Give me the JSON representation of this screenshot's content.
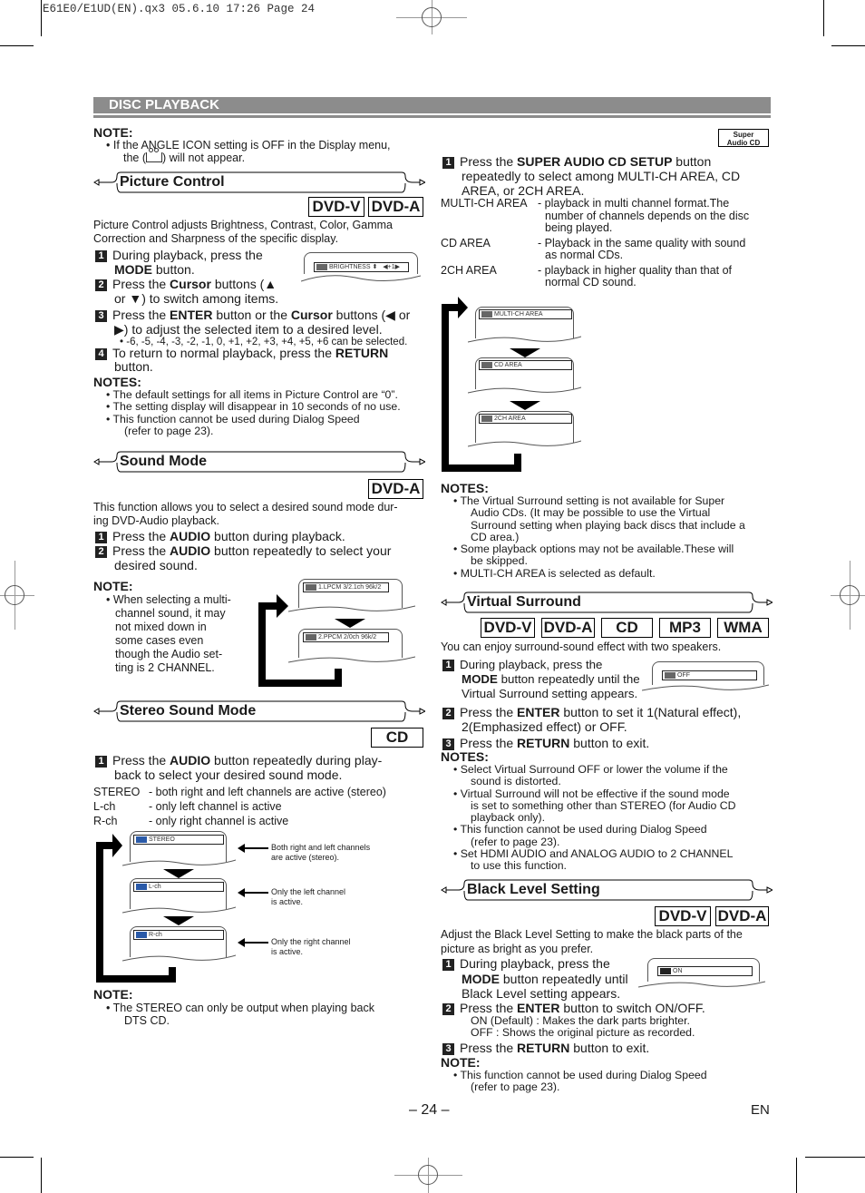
{
  "print_header": "E61E0/E1UD(EN).qx3   05.6.10 17:26   Page 24",
  "section_band": "DISC PLAYBACK",
  "top_note": {
    "heading": "NOTE:",
    "line1": "If the ANGLE ICON setting is OFF in the Display menu,",
    "line2a": "the (",
    "line2b": ") will not appear.",
    "icon": "angle-camera-icon"
  },
  "picture_control": {
    "title": "Picture Control",
    "badges": [
      "DVD-V",
      "DVD-A"
    ],
    "intro1": "Picture Control adjusts Brightness, Contrast, Color, Gamma",
    "intro2": "Correction and Sharpness of the specific display.",
    "step1a": "During playback, press the",
    "step1b_bold": "MODE",
    "step1b": " button.",
    "step2a": "Press the ",
    "step2a_bold": "Cursor",
    "step2a_end": " buttons (▲",
    "step2b": "or ▼) to switch among items.",
    "step3a": "Press the ",
    "step3a_bold1": "ENTER",
    "step3a_mid": " button or the ",
    "step3a_bold2": "Cursor",
    "step3a_end": " buttons (◀ or",
    "step3b": "▶) to adjust the selected item to a desired level.",
    "step3_note": "-6, -5, -4, -3, -2, -1, 0, +1, +2, +3, +4, +5, +6 can be selected.",
    "step4a": "To return to normal playback, press the ",
    "step4a_bold": "RETURN",
    "step4b": "button.",
    "screen": {
      "icon": "PICT",
      "label": "BRIGHTNESS",
      "updown": "⬍",
      "value": "◀+1▶"
    },
    "notes_heading": "NOTES:",
    "notes": [
      "The default settings for all items in Picture Control are “0”.",
      "The setting display will disappear in 10 seconds of no use.",
      "This function cannot be used during Dialog Speed",
      "(refer to page 23)."
    ]
  },
  "sound_mode": {
    "title": "Sound Mode",
    "badges": [
      "DVD-A"
    ],
    "intro1": "This function allows you to select a desired sound mode dur-",
    "intro2": "ing DVD-Audio playback.",
    "step1a": "Press the ",
    "step1_bold": "AUDIO",
    "step1b": " button during playback.",
    "step2a": "Press the ",
    "step2_bold": "AUDIO",
    "step2b": " button repeatedly to select your",
    "step2c": "desired sound.",
    "note_heading": "NOTE:",
    "note_lines": [
      "When selecting a multi-",
      "channel sound, it may",
      "not mixed down in",
      "some cases even",
      "though the Audio set-",
      "ting is 2 CHANNEL."
    ],
    "screens": [
      "1.LPCM 3/2.1ch 96k/2",
      "2.PPCM 2/0ch 96k/2"
    ]
  },
  "stereo_sound_mode": {
    "title": "Stereo Sound Mode",
    "badges": [
      "CD"
    ],
    "step1a": "Press the ",
    "step1_bold": "AUDIO",
    "step1b": " button repeatedly during play-",
    "step1c": "back to select your desired sound mode.",
    "modes": [
      {
        "name": "STEREO",
        "desc": "- both right and left channels are active (stereo)"
      },
      {
        "name": "L-ch",
        "desc": "- only left channel is active"
      },
      {
        "name": "R-ch",
        "desc": "- only right channel is active"
      }
    ],
    "screens": [
      "STEREO",
      "L-ch",
      "R-ch"
    ],
    "callouts": [
      [
        "Both right and left channels",
        "are active (stereo)."
      ],
      [
        "Only the left channel",
        "is active."
      ],
      [
        "Only the right channel",
        "is active."
      ]
    ],
    "note_heading": "NOTE:",
    "note1": "The STEREO can only be output when playing back",
    "note2": "DTS CD."
  },
  "super_audio_cd": {
    "badge_line1": "Super",
    "badge_line2": "Audio CD",
    "step1a": "Press the ",
    "step1_bold": "SUPER AUDIO CD SETUP",
    "step1b": " button",
    "step1c": "repeatedly to select among MULTI-CH AREA, CD",
    "step1d": "AREA, or 2CH AREA.",
    "areas": [
      {
        "name": "MULTI-CH AREA",
        "desc": [
          "- playback in multi channel format.The",
          "number of channels depends on the disc",
          "being played."
        ]
      },
      {
        "name": "CD AREA",
        "desc": [
          "- Playback in the same quality with sound",
          "as normal CDs."
        ]
      },
      {
        "name": "2CH AREA",
        "desc": [
          "- playback in higher quality than that of",
          "normal CD sound."
        ]
      }
    ],
    "screens": [
      "MULTI-CH AREA",
      "CD AREA",
      "2CH AREA"
    ],
    "notes_heading": "NOTES:",
    "notes": [
      [
        "The Virtual Surround setting is not available for Super",
        "Audio CDs. (It may be possible to use the Virtual",
        "Surround setting when playing back discs that include a",
        "CD area.)"
      ],
      [
        "Some playback options may not be available.These will",
        "be skipped."
      ],
      [
        "MULTI-CH AREA is selected as default."
      ]
    ]
  },
  "virtual_surround": {
    "title": "Virtual Surround",
    "badges": [
      "DVD-V",
      "DVD-A",
      "CD",
      "MP3",
      "WMA"
    ],
    "intro": "You can enjoy surround-sound effect with two speakers.",
    "step1a": "During playback, press the",
    "step1_bold": "MODE",
    "step1b": " button repeatedly until the",
    "step1c": "Virtual Surround setting appears.",
    "screen": "OFF",
    "step2a": "Press the ",
    "step2_bold": "ENTER",
    "step2b": " button to set it 1(Natural effect),",
    "step2c": "2(Emphasized effect) or OFF.",
    "step3a": "Press the ",
    "step3_bold": "RETURN",
    "step3b": " button to exit.",
    "notes_heading": "NOTES:",
    "notes": [
      [
        "Select Virtual Surround OFF or lower the volume if the",
        "sound is distorted."
      ],
      [
        "Virtual Surround will not be effective if the sound mode",
        "is set to something other than STEREO (for Audio CD",
        "playback only)."
      ],
      [
        "This function cannot be used during Dialog Speed",
        "(refer to page 23)."
      ],
      [
        "Set HDMI AUDIO and ANALOG AUDIO to 2 CHANNEL",
        "to use this function."
      ]
    ]
  },
  "black_level": {
    "title": "Black Level Setting",
    "badges": [
      "DVD-V",
      "DVD-A"
    ],
    "intro1": "Adjust the Black Level Setting to make the black parts of the",
    "intro2": "picture as bright as you prefer.",
    "step1a": "During playback, press the",
    "step1_bold": "MODE",
    "step1b": " button repeatedly until",
    "step1c": "Black Level setting appears.",
    "screen": "ON",
    "step2a": "Press the ",
    "step2_bold": "ENTER",
    "step2b": " button to switch ON/OFF.",
    "step2_on": "ON (Default) : Makes the dark parts brighter.",
    "step2_off": "OFF : Shows the original picture as recorded.",
    "step3a": "Press the ",
    "step3_bold": "RETURN",
    "step3b": " button to exit.",
    "note_heading": "NOTE:",
    "note1": "This function cannot be used during Dialog Speed",
    "note2": "(refer to page 23)."
  },
  "footer": {
    "page_number": "– 24 –",
    "language": "EN"
  }
}
